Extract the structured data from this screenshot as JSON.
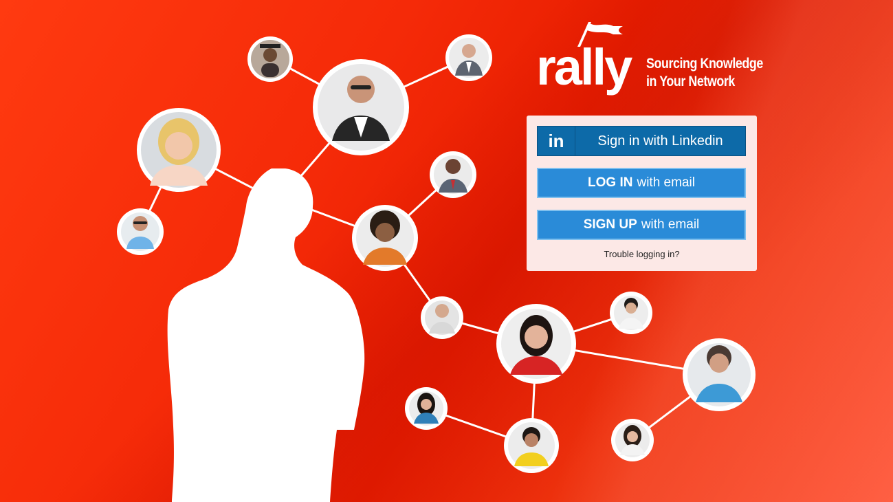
{
  "brand": {
    "logo_text": "rally",
    "tagline_line1": "Sourcing Knowledge",
    "tagline_line2": "in Your Network",
    "accent_color": "#f0300c"
  },
  "login": {
    "linkedin_icon": "in",
    "linkedin_label": "Sign in with Linkedin",
    "login_strong": "LOG IN",
    "login_rest": "with email",
    "signup_strong": "SIGN UP",
    "signup_rest": "with email",
    "trouble_link": "Trouble logging in?"
  },
  "network": {
    "people": [
      "graduate",
      "executive-man",
      "older-man",
      "blonde-woman",
      "man-glasses",
      "man-suit",
      "curly-man",
      "young-man",
      "woman-smiling",
      "asian-man",
      "man-blue-shirt",
      "woman-dark-hair",
      "man-headphones",
      "woman-asian"
    ]
  }
}
